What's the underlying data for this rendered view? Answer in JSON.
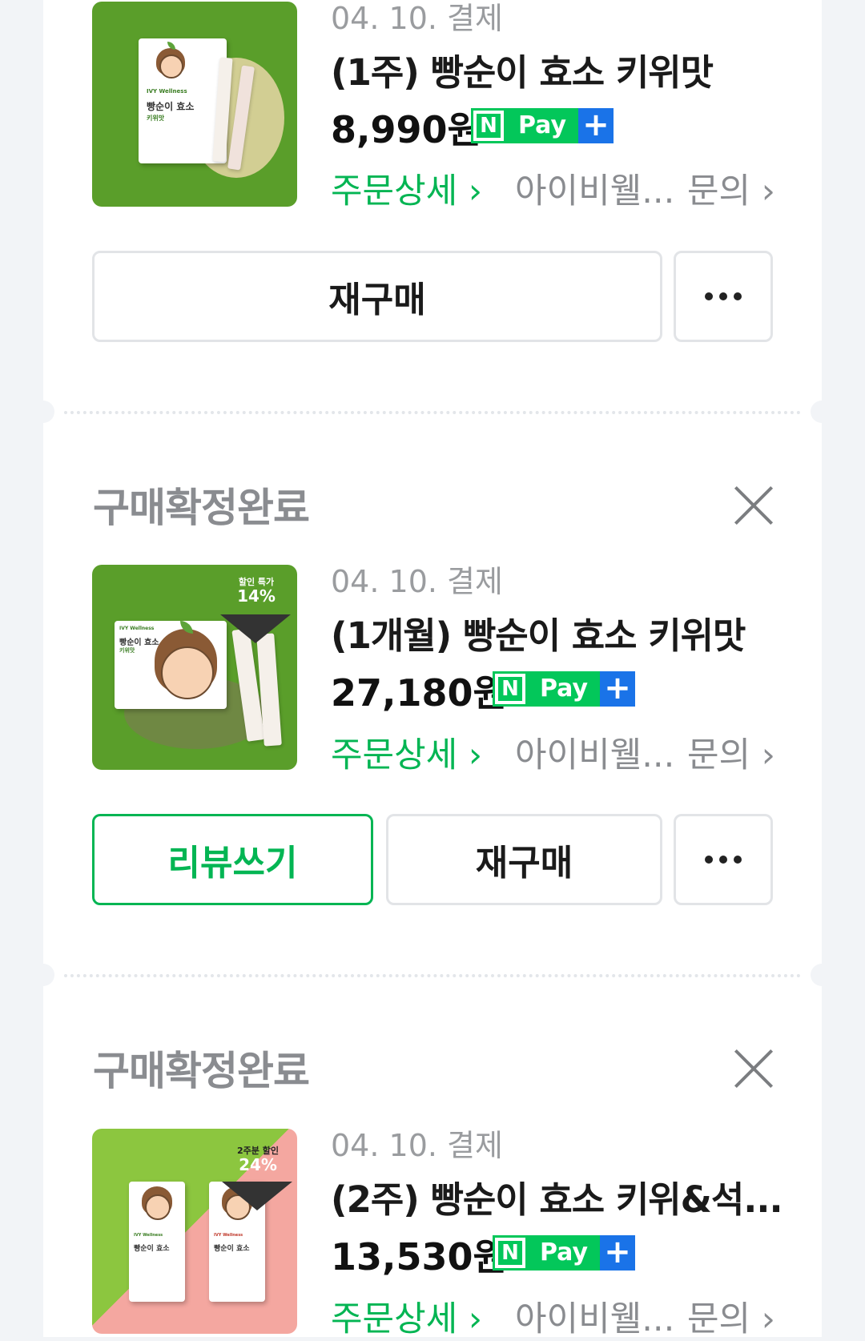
{
  "orders": [
    {
      "date": "04. 10. 결제",
      "title": "(1주) 빵순이 효소 키위맛",
      "price": "8,990원",
      "npay": {
        "n": "N",
        "pay": "Pay",
        "plus": "+"
      },
      "links": {
        "detail": "주문상세 ›",
        "seller": "아이비웰...",
        "ask": "문의 ›"
      },
      "buttons": {
        "rebuy": "재구매"
      },
      "thumb": {
        "brand": "IVY Wellness",
        "name": "빵순이 효소",
        "flavor": "키위맛"
      }
    },
    {
      "status": "구매확정완료",
      "date": "04. 10. 결제",
      "title": "(1개월) 빵순이 효소 키위맛",
      "price": "27,180원",
      "npay": {
        "n": "N",
        "pay": "Pay",
        "plus": "+"
      },
      "links": {
        "detail": "주문상세 ›",
        "seller": "아이비웰...",
        "ask": "문의 ›"
      },
      "buttons": {
        "review": "리뷰쓰기",
        "rebuy": "재구매"
      },
      "thumb": {
        "brand": "IVY Wellness",
        "name": "빵순이 효소",
        "flavor": "키위맛",
        "badge_line1": "할인 특가",
        "badge_line2": "14%"
      }
    },
    {
      "status": "구매확정완료",
      "date": "04. 10. 결제",
      "title": "(2주) 빵순이 효소 키위&석...",
      "price": "13,530원",
      "npay": {
        "n": "N",
        "pay": "Pay",
        "plus": "+"
      },
      "links": {
        "detail": "주문상세 ›",
        "seller": "아이비웰...",
        "ask": "문의 ›"
      },
      "thumb": {
        "brand": "IVY Wellness",
        "name": "빵순이 효소",
        "badge_line1": "2주분 할인",
        "badge_line2": "24%"
      }
    }
  ],
  "colors": {
    "accent": "#03b553",
    "npay_green": "#03c75a",
    "npay_blue": "#1a73e8",
    "background": "#f2f4f7"
  },
  "icons": {
    "close": "close-icon",
    "more": "more-dots-icon"
  }
}
